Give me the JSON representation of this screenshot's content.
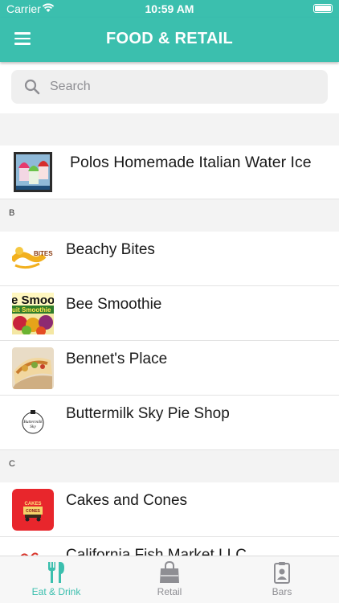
{
  "status": {
    "carrier": "Carrier",
    "time": "10:59 AM"
  },
  "nav": {
    "title": "FOOD & RETAIL"
  },
  "search": {
    "placeholder": "Search"
  },
  "list": {
    "first_item": "Polos Homemade Italian Water Ice",
    "section_b": "B",
    "section_b_items": [
      "Beachy Bites",
      "Bee Smoothie",
      "Bennet's Place",
      "Buttermilk Sky Pie Shop"
    ],
    "section_c": "C",
    "section_c_items": [
      "Cakes and Cones",
      "California Fish Market LLC"
    ],
    "thumb_text": {
      "beachy": "BITES",
      "smoothie_top": "e Smoot",
      "smoothie_sub": "uit Smoothie",
      "buttermilk_top": "Buttermilk",
      "buttermilk_bottom": "Sky",
      "cakes_top": "CAKES",
      "cakes_bottom": "CONES"
    }
  },
  "tabs": {
    "eat": "Eat & Drink",
    "retail": "Retail",
    "bars": "Bars"
  },
  "colors": {
    "accent": "#3bbfae",
    "inactive": "#8e8e93",
    "cakes_red": "#e8262c"
  }
}
